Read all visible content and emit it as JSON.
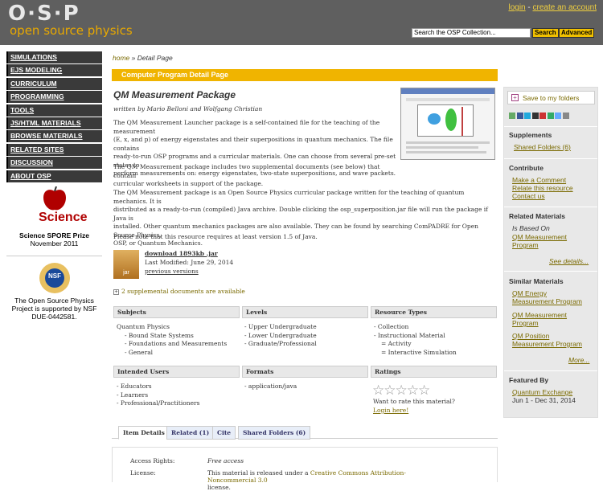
{
  "header": {
    "logo": "O·S·P",
    "logo_sub": "open source physics",
    "login": "login",
    "sep": " - ",
    "create_account": "create an account",
    "search_value": "Search the OSP Collection...",
    "search_button": "Search",
    "advanced_button": "Advanced"
  },
  "nav": {
    "items": [
      "SIMULATIONS",
      "EJS MODELING",
      "CURRICULUM",
      "PROGRAMMING",
      "TOOLS",
      "JS/HTML MATERIALS",
      "BROWSE MATERIALS",
      "RELATED SITES",
      "DISCUSSION",
      "ABOUT OSP"
    ]
  },
  "award": {
    "science_label": "Science",
    "prize": "Science SPORE Prize",
    "date": "November 2011",
    "nsf_label": "NSF",
    "nsf_line1": "The Open Source Physics",
    "nsf_line2": "Project is supported by NSF",
    "nsf_line3": "DUE-0442581."
  },
  "breadcrumb": {
    "home": "home",
    "current": "» Detail Page"
  },
  "bar_title": "Computer Program Detail Page",
  "resource": {
    "title": "QM Measurement Package",
    "author": "written by Mario Belloni and Wolfgang Christian",
    "p1_l1": "The QM Measurement Launcher package is a self-contained file for the teaching of the measurement",
    "p1_l2": "(E, x, and p) of energy eigenstates and their superpositions in quantum mechanics.  The file contains",
    "p1_l3": "ready-to-run OSP programs and a curricular materials.  One can choose from several pre-set states to",
    "p1_l4": "perform measurements on: energy eigenstates, two-state superpositions, and wave packets.",
    "p2_l1": "The QM Measurement package includes two supplemental documents (see below) that contain",
    "p2_l2": "curricular worksheets in support of the package.",
    "p3_l1": "The QM Measurement package is an Open Source Physics curricular package written for the teaching of quantum mechanics.  It is",
    "p3_l2": "distributed as a ready-to-run (compiled) Java archive.  Double clicking the osp_superposition.jar file will run the package if Java is",
    "p3_l3": "installed.  Other quantum mechanics packages are also available.  They can be found by searching ComPADRE for Open Source Physics,",
    "p3_l4": "OSP, or Quantum Mechanics.",
    "p4": "Please note that this resource requires at least version 1.5 of Java.",
    "download_label": "download 1893kb .jar",
    "jar_label": "jar",
    "last_modified": "Last Modified: June 29, 2014",
    "previous_versions": "previous versions",
    "supplemental": "2 supplemental documents are available"
  },
  "grid": {
    "subjects_head": "Subjects",
    "subjects": [
      "Quantum Physics",
      "- Bound State Systems",
      "- Foundations and Measurements",
      "- General"
    ],
    "levels_head": "Levels",
    "levels": [
      "- Upper Undergraduate",
      "- Lower Undergraduate",
      "- Graduate/Professional"
    ],
    "types_head": "Resource Types",
    "types": [
      "- Collection",
      "- Instructional Material",
      "= Activity",
      "= Interactive Simulation"
    ],
    "users_head": "Intended Users",
    "users": [
      "- Educators",
      "- Learners",
      "- Professional/Practitioners"
    ],
    "formats_head": "Formats",
    "formats": [
      "- application/java"
    ],
    "ratings_head": "Ratings",
    "stars": "☆☆☆☆☆",
    "rate_question": "Want to rate this material?",
    "login_here": "Login here!"
  },
  "tabs": [
    "Item Details",
    "Related (1)",
    "Cite",
    "Shared Folders (6)"
  ],
  "details": {
    "access_label": "Access Rights:",
    "access_value": "Free access",
    "license_label": "License:",
    "license_prefix": "This material is released under a ",
    "license_link": "Creative Commons Attribution-Noncommercial 3.0",
    "license_suffix": "license."
  },
  "right": {
    "save": "Save to my folders",
    "supplements_head": "Supplements",
    "shared_folders": "Shared Folders (6)",
    "contribute_head": "Contribute",
    "make_comment": "Make a Comment",
    "relate": "Relate this resource",
    "contact": "Contact us",
    "related_head": "Related Materials",
    "is_based_on": "Is Based On",
    "qm_meas_1": "QM Measurement",
    "qm_meas_2": "Program",
    "see_details": "See details...",
    "similar_head": "Similar Materials",
    "sim1_a": "QM Energy",
    "sim1_b": "Measurement Program",
    "sim2_a": "QM Measurement",
    "sim2_b": "Program",
    "sim3_a": "QM Position",
    "sim3_b": "Measurement Program",
    "more": "More...",
    "featured_head": "Featured By",
    "quantum_exchange": "Quantum Exchange",
    "featured_dates": "Jun 1 - Dec 31, 2014"
  },
  "colors": {
    "accent": "#f0b400",
    "nav_bg": "#3a3a3a",
    "header_bg": "#5f5f5f",
    "link": "#7a6a00"
  }
}
